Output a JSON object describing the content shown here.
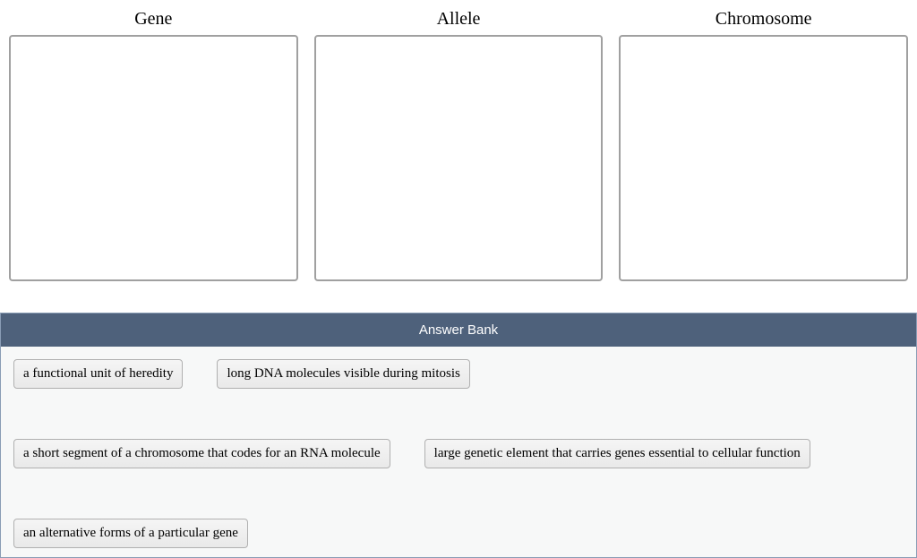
{
  "categories": [
    {
      "label": "Gene"
    },
    {
      "label": "Allele"
    },
    {
      "label": "Chromosome"
    }
  ],
  "answer_bank": {
    "header": "Answer Bank",
    "items": [
      "a functional unit of heredity",
      "long DNA molecules visible during mitosis",
      "a short segment of a chromosome that codes for an RNA molecule",
      "large genetic element that carries genes essential to cellular function",
      "an alternative forms of a particular gene"
    ]
  }
}
